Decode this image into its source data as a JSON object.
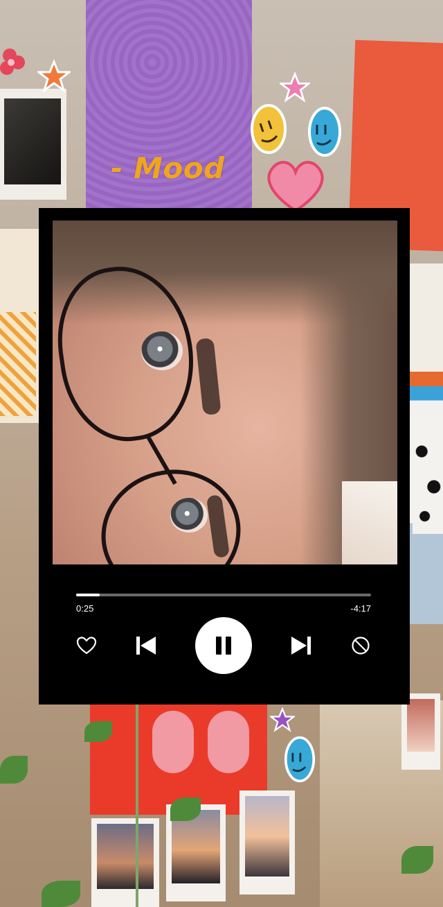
{
  "header": {
    "title": "- Mood"
  },
  "player": {
    "progress": {
      "elapsed": "0:25",
      "remaining": "-4:17",
      "fraction": 0.08
    },
    "controls": {
      "like_icon": "heart-outline-icon",
      "previous_icon": "skip-previous-icon",
      "play_pause_icon": "pause-icon",
      "next_icon": "skip-next-icon",
      "block_icon": "block-icon"
    },
    "colors": {
      "background": "#000000",
      "foreground": "#ffffff",
      "track": "#6a6a6a",
      "title": "#f0a51e"
    }
  }
}
